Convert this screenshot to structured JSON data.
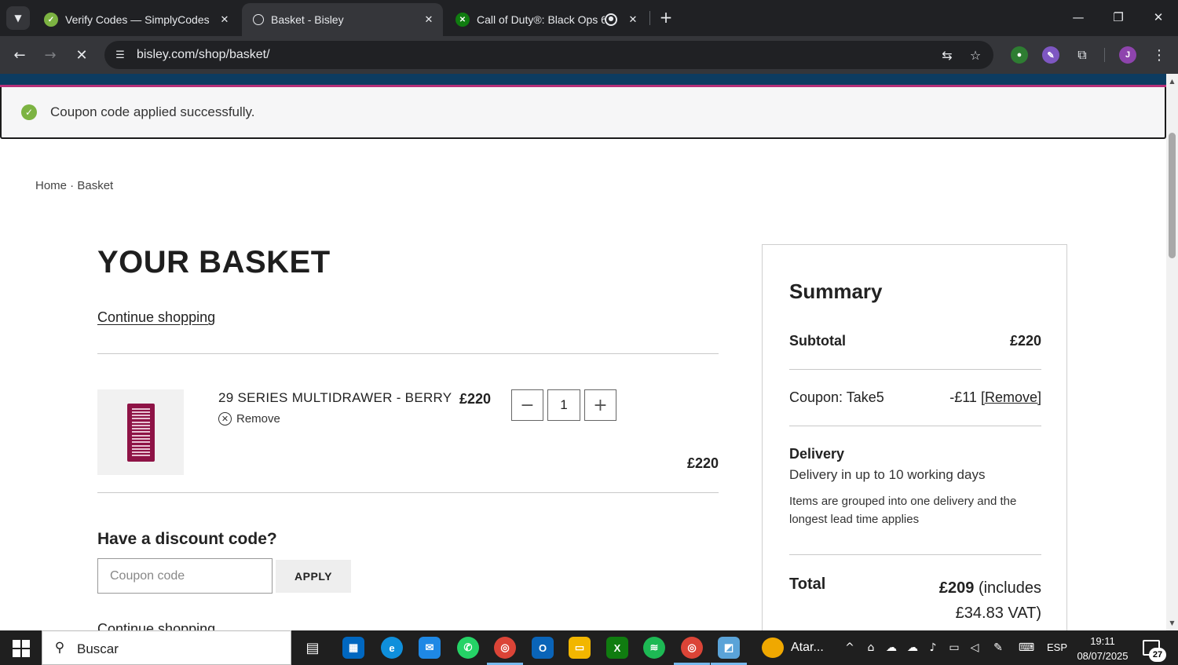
{
  "browser": {
    "tabs": [
      {
        "title": "Verify Codes — SimplyCodes",
        "active": false
      },
      {
        "title": "Basket - Bisley",
        "active": true
      },
      {
        "title": "Call of Duty®: Black Ops 6 -",
        "active": false
      }
    ],
    "url": "bisley.com/shop/basket/",
    "profile_initial": "J"
  },
  "page": {
    "notice": "Coupon code applied successfully.",
    "breadcrumb": {
      "home": "Home",
      "separator": " · ",
      "current": "Basket"
    },
    "title": "YOUR BASKET",
    "continue_shopping": "Continue shopping",
    "item": {
      "name": "29 SERIES MULTIDRAWER - BERRY",
      "remove": "Remove",
      "price": "£220",
      "quantity": "1",
      "line_total": "£220",
      "color": "#8e1346"
    },
    "discount": {
      "heading": "Have a discount code?",
      "placeholder": "Coupon code",
      "apply": "APPLY"
    },
    "continue_shopping_bottom": "Continue shopping"
  },
  "summary": {
    "heading": "Summary",
    "subtotal_label": "Subtotal",
    "subtotal_value": "£220",
    "coupon_label": "Coupon: Take5",
    "coupon_value": "-£11",
    "coupon_remove": "[Remove]",
    "delivery_heading": "Delivery",
    "delivery_time": "Delivery in up to 10 working days",
    "delivery_note": "Items are grouped into one delivery and the longest lead time applies",
    "total_label": "Total",
    "total_amount": "£209",
    "total_vat_1": " (includes",
    "total_vat_2": "£34.83 VAT)"
  },
  "taskbar": {
    "search": "Buscar",
    "weather": "Atar...",
    "language": "ESP",
    "time": "19:11",
    "date": "08/07/2025",
    "notifications": "27"
  },
  "colors": {
    "brand_navy": "#0d3c61",
    "brand_pink": "#b62f78",
    "success_green": "#7cb342"
  }
}
